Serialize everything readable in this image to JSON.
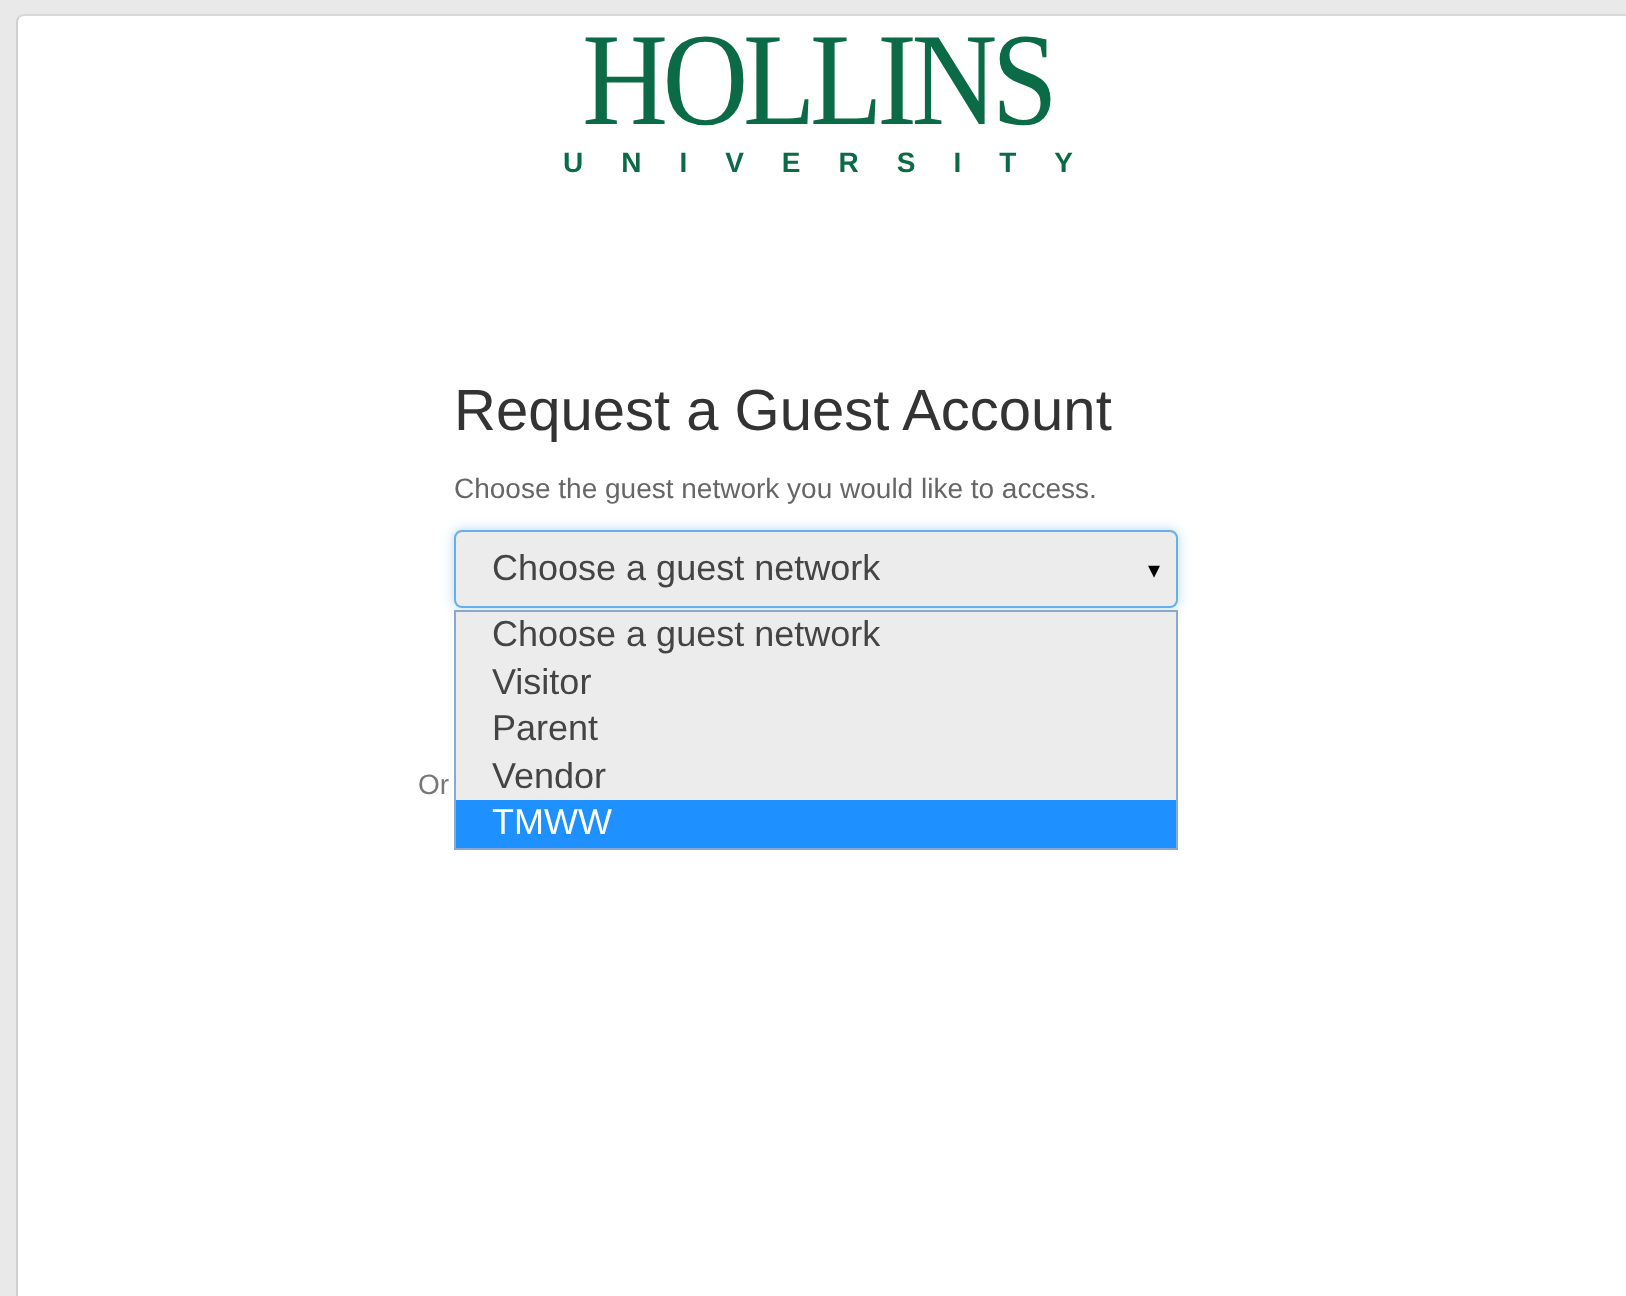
{
  "logo": {
    "name": "HOLLINS",
    "subtitle": "UNIVERSITY"
  },
  "heading": "Request a Guest Account",
  "instructions": "Choose the guest network you would like to access.",
  "network_select": {
    "value": "Choose a guest network",
    "arrow": "▾",
    "expanded": true,
    "options": [
      {
        "label": "Choose a guest network",
        "highlighted": false
      },
      {
        "label": "Visitor",
        "highlighted": false
      },
      {
        "label": "Parent",
        "highlighted": false
      },
      {
        "label": "Vendor",
        "highlighted": false
      },
      {
        "label": "TMWW",
        "highlighted": true
      }
    ]
  },
  "or_text": "Or"
}
